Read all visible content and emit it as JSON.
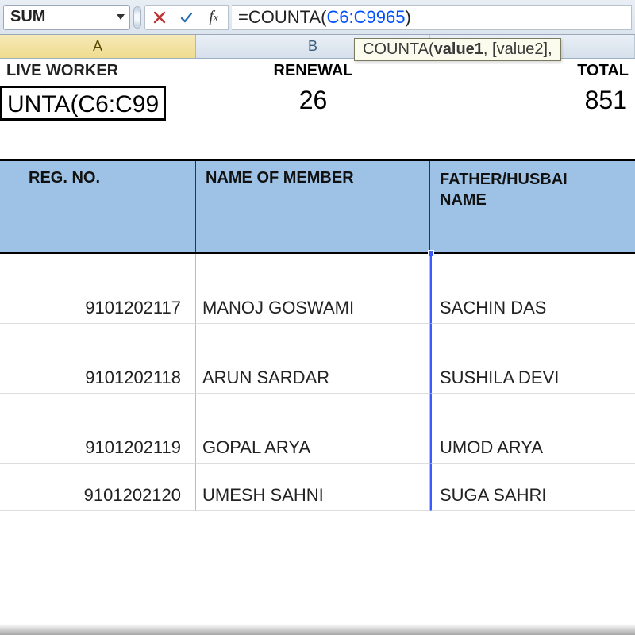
{
  "name_box": "SUM",
  "formula_bar": {
    "prefix": "=COUNTA(",
    "range": "C6:C9965",
    "suffix": ")"
  },
  "tooltip": {
    "fn": "COUNTA",
    "sig_bold": "value1",
    "sig_rest": ", [value2],"
  },
  "col_letters": {
    "A": "A",
    "B": "B",
    "C": ""
  },
  "row1": {
    "A": "LIVE WORKER",
    "B": "RENEWAL",
    "C": "TOTAL"
  },
  "row2": {
    "A": "UNTA(C6:C99",
    "B": "26",
    "C": "851"
  },
  "headers": {
    "A": "REG. NO.",
    "B": "NAME OF MEMBER",
    "C": "FATHER/HUSBAI\nNAME"
  },
  "rows": [
    {
      "reg": "9101202117",
      "name": "MANOJ GOSWAMI",
      "father": "SACHIN DAS"
    },
    {
      "reg": "9101202118",
      "name": "ARUN SARDAR",
      "father": "SUSHILA DEVI"
    },
    {
      "reg": "9101202119",
      "name": "GOPAL ARYA",
      "father": "UMOD ARYA"
    },
    {
      "reg": "9101202120",
      "name": "UMESH SAHNI",
      "father": "SUGA SAHRI"
    }
  ]
}
